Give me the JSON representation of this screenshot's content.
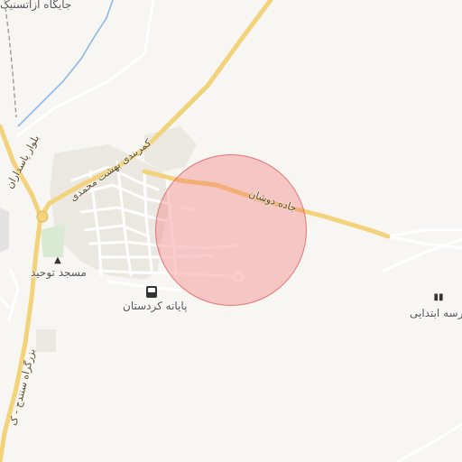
{
  "map": {
    "colors": {
      "background": "#f8f6f2",
      "major_road": "#f2d27a",
      "minor_road": "#ffffff",
      "urban_area": "#ebe8e2",
      "river": "#8ab8e8",
      "railway": "#9a9a9a",
      "park": "#d8ead2",
      "highlight_circle": "#f06e6e"
    },
    "labels": {
      "top_partial": "جایگاه آزاتسنیک",
      "road_kamarbandi": "کمربندی بهشت محمدی",
      "road_jadeh_dushan": "جاده دوشان",
      "road_bolvar": "بلوار پاسداران",
      "mosque": "مسجد توحید",
      "terminal": "پایانه کردستان",
      "school": "مدرسه ابتدایی",
      "highway_left": "بزرگراه سنندج - ک"
    },
    "icons": {
      "mosque": "mosque-icon",
      "terminal": "bus-icon",
      "school": "school-icon"
    },
    "highlight": {
      "shape": "circle",
      "color": "#f06e6e"
    }
  }
}
